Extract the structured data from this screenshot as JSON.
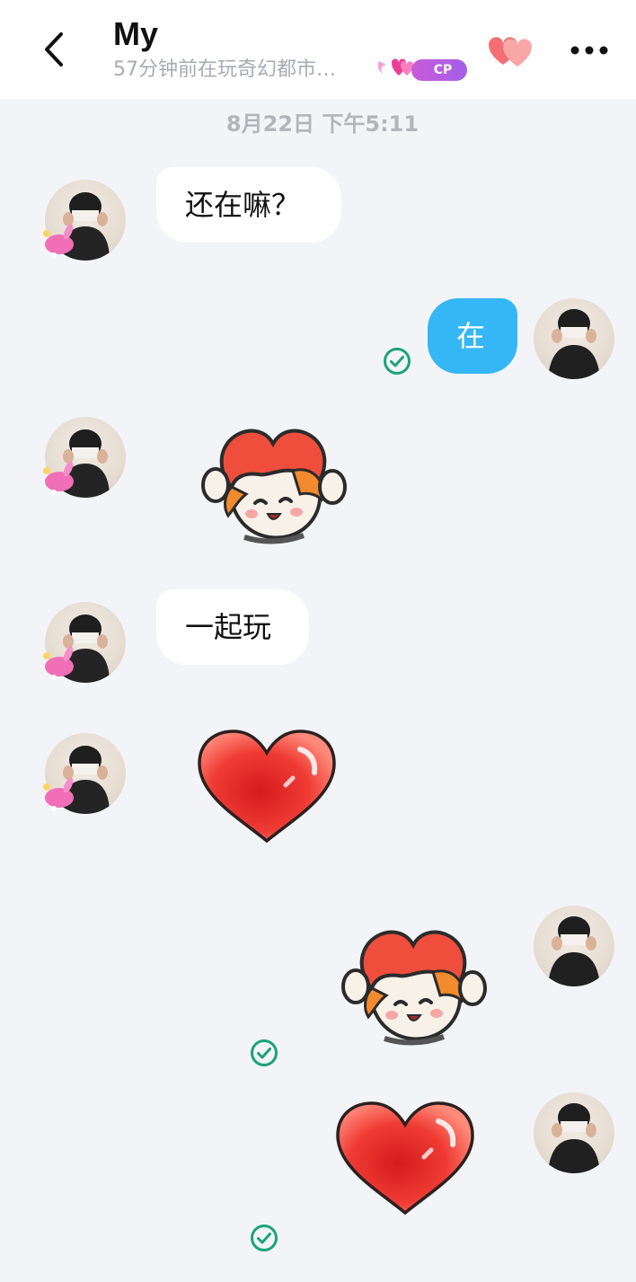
{
  "header": {
    "title": "My",
    "subtitle": "57分钟前在玩奇幻都市…",
    "cp_label": "CP"
  },
  "chat": {
    "timestamp": "8月22日 下午5:11",
    "messages": [
      {
        "sender": "other",
        "type": "text",
        "text": "还在嘛？"
      },
      {
        "sender": "me",
        "type": "text",
        "text": "在",
        "status": "read"
      },
      {
        "sender": "other",
        "type": "sticker",
        "sticker": "heart-girl-sticker"
      },
      {
        "sender": "other",
        "type": "text",
        "text": "一起玩"
      },
      {
        "sender": "other",
        "type": "sticker",
        "sticker": "red-heart-sticker"
      },
      {
        "sender": "me",
        "type": "sticker",
        "sticker": "heart-girl-sticker",
        "status": "read"
      },
      {
        "sender": "me",
        "type": "sticker",
        "sticker": "red-heart-sticker",
        "status": "read"
      }
    ]
  },
  "icons": {
    "back": "chevron-left-icon",
    "hearts": "double-heart-icon",
    "more": "more-dots-icon",
    "read": "check-circle-icon"
  },
  "colors": {
    "background": "#f3f4f8",
    "outgoing_bubble": "#35b6f5",
    "incoming_bubble": "#ffffff",
    "read_check": "#1aa37a",
    "cp_pill": "#b65de0",
    "heart": "#f27b7b"
  }
}
